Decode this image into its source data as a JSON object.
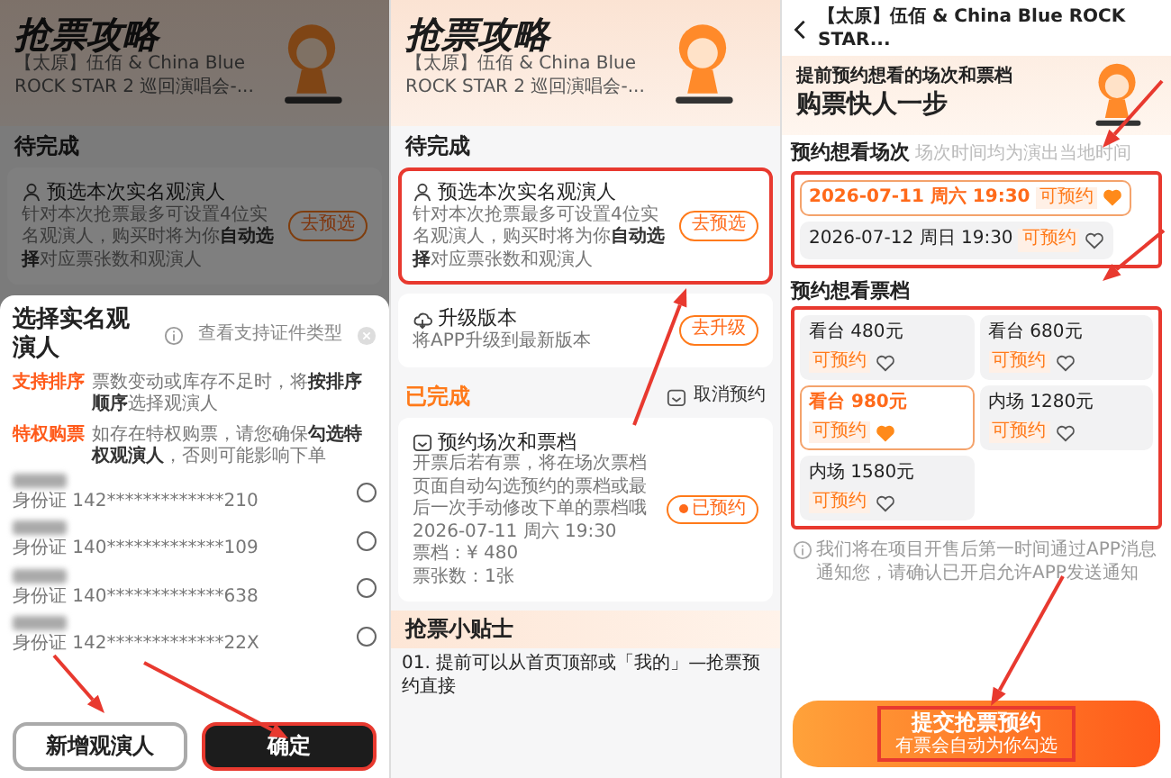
{
  "left_screen": {
    "background": {
      "logo": "抢票攻略",
      "event_lines": [
        "【太原】伍佰 & China Blue",
        "ROCK STAR 2 巡回演唱会-..."
      ],
      "section": "待完成",
      "task": {
        "title": "预选本次实名观演人",
        "description": "针对本次抢票最多可设置4位实名观演人，购买时将为你**自动选择**对应票张数和观演人",
        "button": "去预选",
        "done": false,
        "highlighted": false
      }
    },
    "sheet": {
      "title": "选择实名观演人",
      "help_link": "查看支持证件类型",
      "notes": [
        {
          "tag": "支持排序",
          "text": "票数变动或库存不足时，将**按排序顺序**选择观演人"
        },
        {
          "tag": "特权购票",
          "text": "如存在特权购票，请您确保**勾选特权观演人**，否则可能影响下单"
        }
      ],
      "viewers": [
        {
          "id_text": "身份证 142*************210",
          "checked": false
        },
        {
          "id_text": "身份证 140*************109",
          "checked": false
        },
        {
          "id_text": "身份证 140*************638",
          "checked": false
        },
        {
          "id_text": "身份证 142*************22X",
          "checked": false
        }
      ],
      "buttons": [
        {
          "label": "新增观演人",
          "kind": "secondary",
          "highlighted": false
        },
        {
          "label": "确定",
          "kind": "primary",
          "highlighted": true
        }
      ]
    }
  },
  "guide_screen": {
    "logo": "抢票攻略",
    "event_lines": [
      "【太原】伍佰 & China Blue",
      "ROCK STAR 2 巡回演唱会-..."
    ],
    "sections": [
      {
        "title": "待完成",
        "tasks": [
          {
            "title": "预选本次实名观演人",
            "description": "针对本次抢票最多可设置4位实名观演人，购买时将为你**自动选择**对应票张数和观演人",
            "button": "去预选",
            "done": false,
            "highlighted": true
          },
          {
            "title": "升级版本",
            "description": "将APP升级到最新版本",
            "button": "去升级",
            "done": false,
            "highlighted": false
          }
        ]
      },
      {
        "title": "已完成",
        "action": "取消预约",
        "tasks": [
          {
            "title": "预约场次和票档",
            "description": "开票后若有票，将在场次票档页面自动勾选预约的票档或最后一次手动修改下单的票档哦",
            "details": [
              "2026-07-11 周六 19:30",
              "票档：¥ 480",
              "票张数：1张"
            ],
            "button": "已预约",
            "done": true,
            "highlighted": false
          }
        ]
      }
    ],
    "tips": {
      "title": "抢票小贴士",
      "items": [
        "01. 提前可以从首页顶部或「我的」—抢票预约直接"
      ]
    }
  },
  "reservation_screen": {
    "header": "【太原】伍佰 & China Blue ROCK STAR...",
    "banner": {
      "subtitle": "提前预约想看的场次和票档",
      "title": "购票快人一步"
    },
    "sessions": {
      "title": "预约想看场次",
      "hint": "场次时间均为演出当地时间",
      "highlighted": true,
      "options": [
        {
          "label": "2026-07-11 周六 19:30",
          "tag": "可预约",
          "selected": true
        },
        {
          "label": "2026-07-12 周日 19:30",
          "tag": "可预约",
          "selected": false
        }
      ]
    },
    "tiers": {
      "title": "预约想看票档",
      "highlighted": true,
      "options": [
        {
          "label": "看台 480元",
          "tag": "可预约",
          "selected": false
        },
        {
          "label": "看台 680元",
          "tag": "可预约",
          "selected": false
        },
        {
          "label": "看台 980元",
          "tag": "可预约",
          "selected": true
        },
        {
          "label": "内场 1280元",
          "tag": "可预约",
          "selected": false
        },
        {
          "label": "内场 1580元",
          "tag": "可预约",
          "selected": false
        }
      ]
    },
    "notice": "我们将在项目开售后第一时间通过APP消息通知您，请确认已开启允许APP发送通知",
    "submit": {
      "label": "提交抢票预约",
      "sublabel": "有票会自动为你勾选",
      "highlighted": true
    }
  }
}
